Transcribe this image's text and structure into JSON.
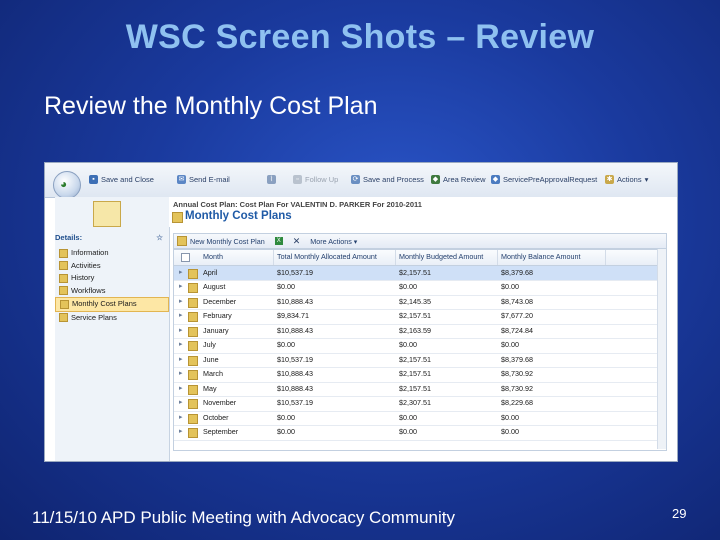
{
  "slide": {
    "title": "WSC Screen Shots – Review",
    "subtitle": "Review the Monthly Cost Plan",
    "footer": "11/15/10 APD Public Meeting with Advocacy Community",
    "page_number": "29"
  },
  "toolbar": {
    "items": [
      "Save and Close",
      "Send E-mail",
      "Follow Up",
      "Save and Process",
      "Area Review",
      "ServicePreApprovalRequest",
      "Actions"
    ]
  },
  "form": {
    "subtitle": "Annual Cost Plan: Cost Plan For VALENTIN D. PARKER For 2010-2011",
    "title": "Monthly Cost Plans"
  },
  "sidebar": {
    "header": "Details:",
    "items": [
      "Information",
      "Activities",
      "History",
      "Workflows",
      "Monthly Cost Plans",
      "Service Plans"
    ],
    "active_index": 4
  },
  "grid_toolbar": {
    "new_label": "New Monthly Cost Plan",
    "more_actions": "More Actions"
  },
  "grid": {
    "columns": [
      "Month",
      "Total Monthly Allocated Amount",
      "Monthly Budgeted Amount",
      "Monthly Balance Amount"
    ],
    "rows": [
      [
        "April",
        "$10,537.19",
        "$2,157.51",
        "$8,379.68"
      ],
      [
        "August",
        "$0.00",
        "$0.00",
        "$0.00"
      ],
      [
        "December",
        "$10,888.43",
        "$2,145.35",
        "$8,743.08"
      ],
      [
        "February",
        "$9,834.71",
        "$2,157.51",
        "$7,677.20"
      ],
      [
        "January",
        "$10,888.43",
        "$2,163.59",
        "$8,724.84"
      ],
      [
        "July",
        "$0.00",
        "$0.00",
        "$0.00"
      ],
      [
        "June",
        "$10,537.19",
        "$2,157.51",
        "$8,379.68"
      ],
      [
        "March",
        "$10,888.43",
        "$2,157.51",
        "$8,730.92"
      ],
      [
        "May",
        "$10,888.43",
        "$2,157.51",
        "$8,730.92"
      ],
      [
        "November",
        "$10,537.19",
        "$2,307.51",
        "$8,229.68"
      ],
      [
        "October",
        "$0.00",
        "$0.00",
        "$0.00"
      ],
      [
        "September",
        "$0.00",
        "$0.00",
        "$0.00"
      ]
    ],
    "selected_index": 0
  }
}
